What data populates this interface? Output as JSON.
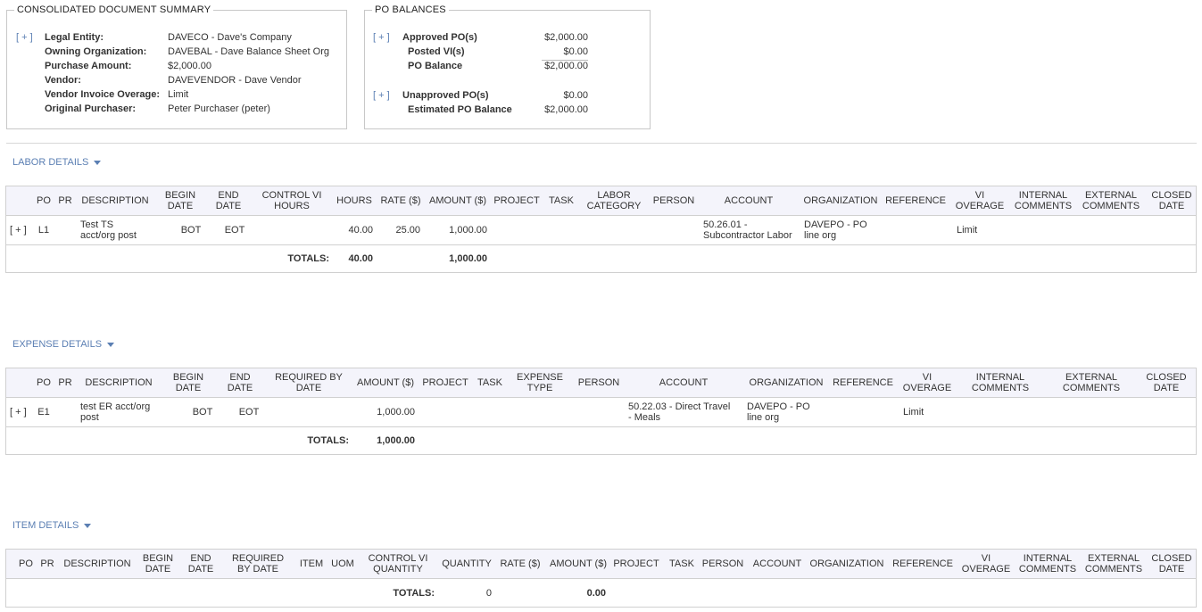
{
  "summary": {
    "title": "CONSOLIDATED DOCUMENT SUMMARY",
    "toggle": "[ + ]",
    "fields": [
      {
        "label": "Legal Entity:",
        "value": "DAVECO - Dave's Company"
      },
      {
        "label": "Owning Organization:",
        "value": "DAVEBAL - Dave Balance Sheet Org"
      },
      {
        "label": "Purchase Amount:",
        "value": "$2,000.00"
      },
      {
        "label": "Vendor:",
        "value": "DAVEVENDOR - Dave Vendor"
      },
      {
        "label": "Vendor Invoice Overage:",
        "value": "Limit"
      },
      {
        "label": "Original Purchaser:",
        "value": "Peter Purchaser (peter)"
      }
    ]
  },
  "po_balances": {
    "title": "PO BALANCES",
    "toggle": "[ + ]",
    "approved_label": "Approved PO(s)",
    "approved_value": "$2,000.00",
    "posted_label": "Posted VI(s)",
    "posted_value": "$0.00",
    "balance_label": "PO Balance",
    "balance_value": "$2,000.00",
    "unapproved_label": "Unapproved PO(s)",
    "unapproved_value": "$0.00",
    "estimated_label": "Estimated PO Balance",
    "estimated_value": "$2,000.00"
  },
  "labor": {
    "section_label": "LABOR DETAILS",
    "headers": [
      "PO",
      "PR",
      "DESCRIPTION",
      "BEGIN\nDATE",
      "END\nDATE",
      "CONTROL VI\nHOURS",
      "HOURS",
      "RATE ($)",
      "AMOUNT ($)",
      "PROJECT",
      "TASK",
      "LABOR\nCATEGORY",
      "PERSON",
      "ACCOUNT",
      "ORGANIZATION",
      "REFERENCE",
      "VI\nOVERAGE",
      "INTERNAL\nCOMMENTS",
      "EXTERNAL\nCOMMENTS",
      "CLOSED\nDATE"
    ],
    "row": {
      "toggle": "[ + ]",
      "po": "L1",
      "description": "Test TS\nacct/org post",
      "begin": "BOT",
      "end": "EOT",
      "hours": "40.00",
      "rate": "25.00",
      "amount": "1,000.00",
      "account": "50.26.01 -\nSubcontractor Labor",
      "organization": "DAVEPO - PO\nline org",
      "overage": "Limit"
    },
    "totals": {
      "label": "TOTALS:",
      "hours": "40.00",
      "amount": "1,000.00"
    }
  },
  "expense": {
    "section_label": "EXPENSE DETAILS",
    "headers": [
      "PO",
      "PR",
      "DESCRIPTION",
      "BEGIN\nDATE",
      "END\nDATE",
      "REQUIRED BY\nDATE",
      "AMOUNT ($)",
      "PROJECT",
      "TASK",
      "EXPENSE\nTYPE",
      "PERSON",
      "ACCOUNT",
      "ORGANIZATION",
      "REFERENCE",
      "VI\nOVERAGE",
      "INTERNAL\nCOMMENTS",
      "EXTERNAL\nCOMMENTS",
      "CLOSED\nDATE"
    ],
    "row": {
      "toggle": "[ + ]",
      "po": "E1",
      "description": "test ER acct/org\npost",
      "begin": "BOT",
      "end": "EOT",
      "amount": "1,000.00",
      "account": "50.22.03 - Direct Travel\n- Meals",
      "organization": "DAVEPO - PO\nline org",
      "overage": "Limit"
    },
    "totals": {
      "label": "TOTALS:",
      "amount": "1,000.00"
    }
  },
  "item": {
    "section_label": "ITEM DETAILS",
    "headers": [
      "PO",
      "PR",
      "DESCRIPTION",
      "BEGIN\nDATE",
      "END\nDATE",
      "REQUIRED\nBY DATE",
      "ITEM",
      "UOM",
      "CONTROL VI\nQUANTITY",
      "QUANTITY",
      "RATE ($)",
      "AMOUNT ($)",
      "PROJECT",
      "TASK",
      "PERSON",
      "ACCOUNT",
      "ORGANIZATION",
      "REFERENCE",
      "VI\nOVERAGE",
      "INTERNAL\nCOMMENTS",
      "EXTERNAL\nCOMMENTS",
      "CLOSED\nDATE"
    ],
    "totals": {
      "label": "TOTALS:",
      "quantity": "0",
      "amount": "0.00"
    }
  }
}
